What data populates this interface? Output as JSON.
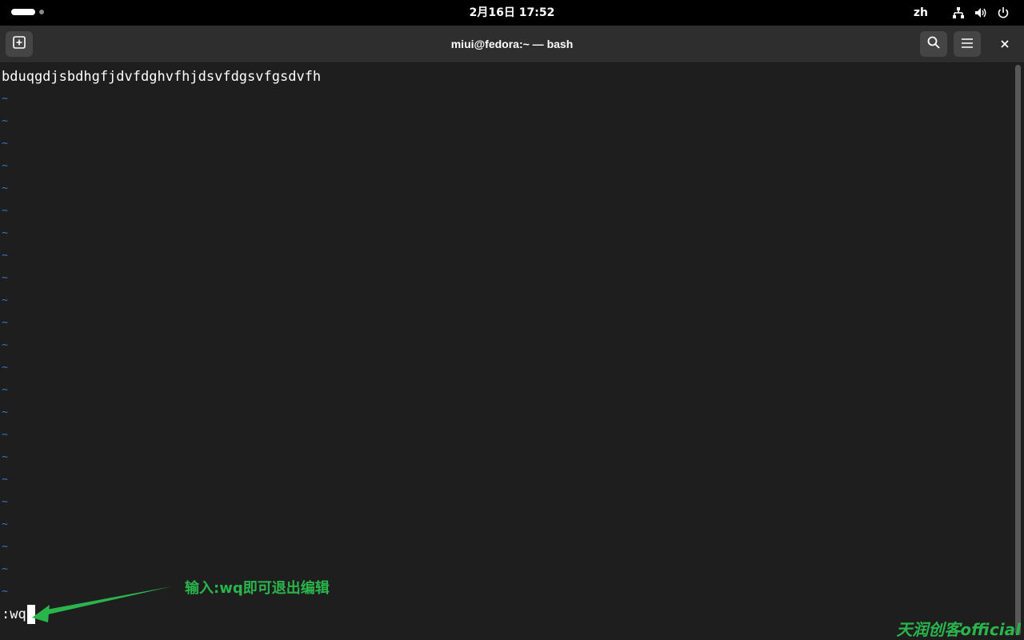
{
  "topbar": {
    "clock": "2月16日  17:52",
    "lang": "zh",
    "icons": [
      "network-icon",
      "volume-icon",
      "power-icon"
    ]
  },
  "window": {
    "title": "miui@fedora:~ — bash"
  },
  "terminal": {
    "first_line": "bduqgdjsbdhgfjdvfdghvfhjdsvfdgsvfgsdvfh",
    "tilde": "~",
    "command": ":wq",
    "colors": {
      "background": "#1e1e1e",
      "text": "#ffffff",
      "tilde": "#2a7bd0"
    }
  },
  "annotation": {
    "text": "输入:wq即可退出编辑",
    "color": "#2ab54c"
  },
  "watermark": {
    "text": "天润创客official"
  }
}
